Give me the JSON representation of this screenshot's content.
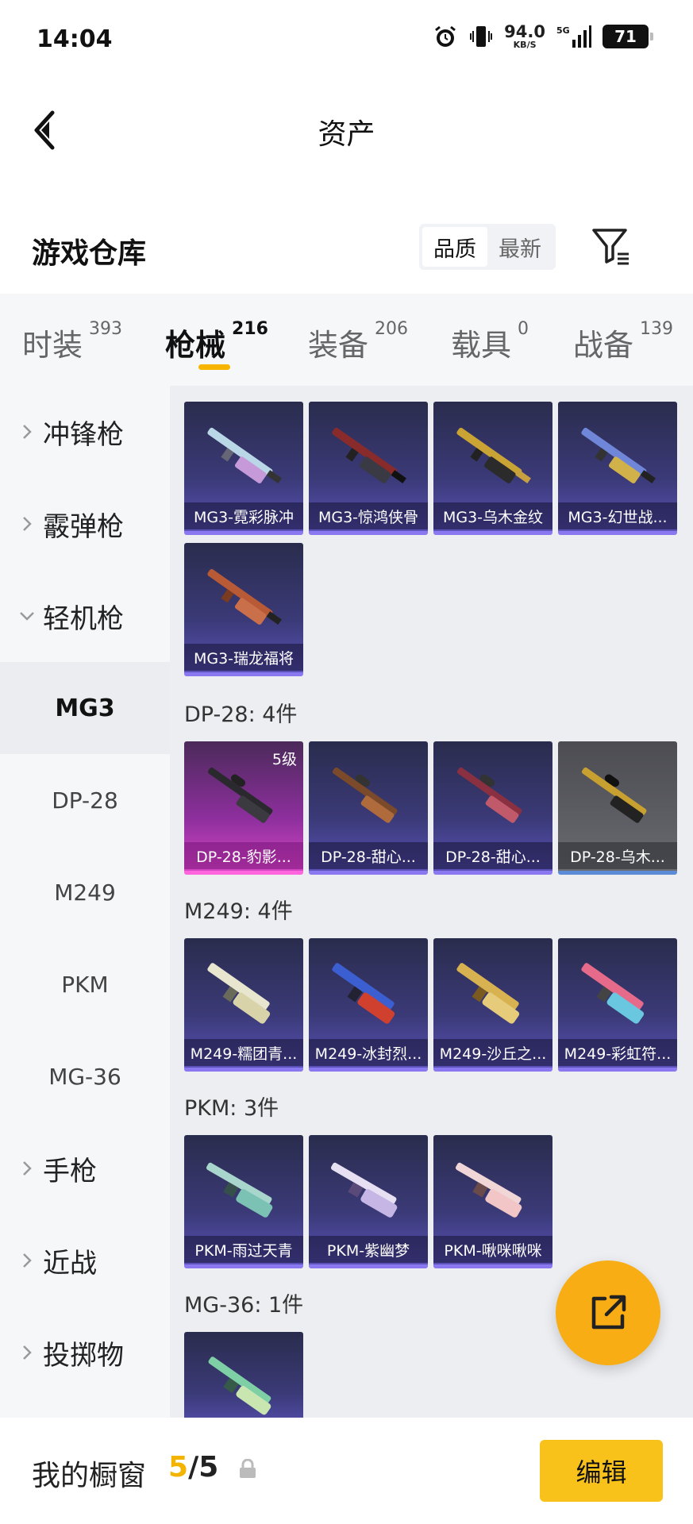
{
  "status_bar": {
    "time": "14:04",
    "net_speed": "94.0",
    "net_unit": "KB/S",
    "network_type": "5G",
    "battery": "71",
    "icons": [
      "alarm-icon",
      "vibrate-icon",
      "signal-icon",
      "battery-icon"
    ]
  },
  "header": {
    "title": "资产",
    "back_icon": "chevron-left-icon"
  },
  "warehouse": {
    "title": "游戏仓库",
    "sort_options": [
      "品质",
      "最新"
    ],
    "sort_selected": "品质",
    "filter_icon": "filter-icon"
  },
  "tabs": [
    {
      "label": "时装",
      "count": "393",
      "active": false
    },
    {
      "label": "枪械",
      "count": "216",
      "active": true
    },
    {
      "label": "装备",
      "count": "206",
      "active": false
    },
    {
      "label": "载具",
      "count": "0",
      "active": false
    },
    {
      "label": "战备",
      "count": "139",
      "active": false
    }
  ],
  "sidebar": {
    "items": [
      {
        "label": "冲锋枪",
        "type": "group",
        "expanded": false
      },
      {
        "label": "霰弹枪",
        "type": "group",
        "expanded": false
      },
      {
        "label": "轻机枪",
        "type": "group",
        "expanded": true
      },
      {
        "label": "MG3",
        "type": "sub",
        "active": true
      },
      {
        "label": "DP-28",
        "type": "sub",
        "active": false
      },
      {
        "label": "M249",
        "type": "sub",
        "active": false
      },
      {
        "label": "PKM",
        "type": "sub",
        "active": false
      },
      {
        "label": "MG-36",
        "type": "sub",
        "active": false
      },
      {
        "label": "手枪",
        "type": "group",
        "expanded": false
      },
      {
        "label": "近战",
        "type": "group",
        "expanded": false
      },
      {
        "label": "投掷物",
        "type": "group",
        "expanded": false
      }
    ]
  },
  "sections": [
    {
      "header": "",
      "items": [
        {
          "name": "MG3-霓彩脉冲",
          "style": "purple"
        },
        {
          "name": "MG3-惊鸿侠骨",
          "style": "purple"
        },
        {
          "name": "MG3-乌木金纹",
          "style": "purple"
        },
        {
          "name": "MG3-幻世战...",
          "style": "purple"
        },
        {
          "name": "MG3-瑞龙福将",
          "style": "purple"
        }
      ]
    },
    {
      "header": "DP-28: 4件",
      "items": [
        {
          "name": "DP-28-豹影...",
          "style": "pink",
          "level": "5级"
        },
        {
          "name": "DP-28-甜心...",
          "style": "purple"
        },
        {
          "name": "DP-28-甜心...",
          "style": "purple"
        },
        {
          "name": "DP-28-乌木...",
          "style": "grey"
        }
      ]
    },
    {
      "header": "M249: 4件",
      "items": [
        {
          "name": "M249-糯团青...",
          "style": "purple"
        },
        {
          "name": "M249-冰封烈...",
          "style": "purple"
        },
        {
          "name": "M249-沙丘之...",
          "style": "purple"
        },
        {
          "name": "M249-彩虹符...",
          "style": "purple"
        }
      ]
    },
    {
      "header": "PKM: 3件",
      "items": [
        {
          "name": "PKM-雨过天青",
          "style": "purple"
        },
        {
          "name": "PKM-紫幽梦",
          "style": "purple"
        },
        {
          "name": "PKM-啾咪啾咪",
          "style": "purple"
        }
      ]
    },
    {
      "header": "MG-36: 1件",
      "items": [
        {
          "name": "",
          "style": "purple"
        }
      ]
    }
  ],
  "fab": {
    "icon": "share-icon"
  },
  "bottom_bar": {
    "label": "我的橱窗",
    "current": "5",
    "separator": "/",
    "max": "5",
    "lock_icon": "lock-icon",
    "edit_label": "编辑"
  },
  "colors": {
    "accent": "#f7b500",
    "edit_button": "#f9c21a",
    "fab": "#f9ad14",
    "card_purple": "#3b3a78",
    "card_pink": "#d447c2",
    "card_grey": "#5d5d64"
  }
}
